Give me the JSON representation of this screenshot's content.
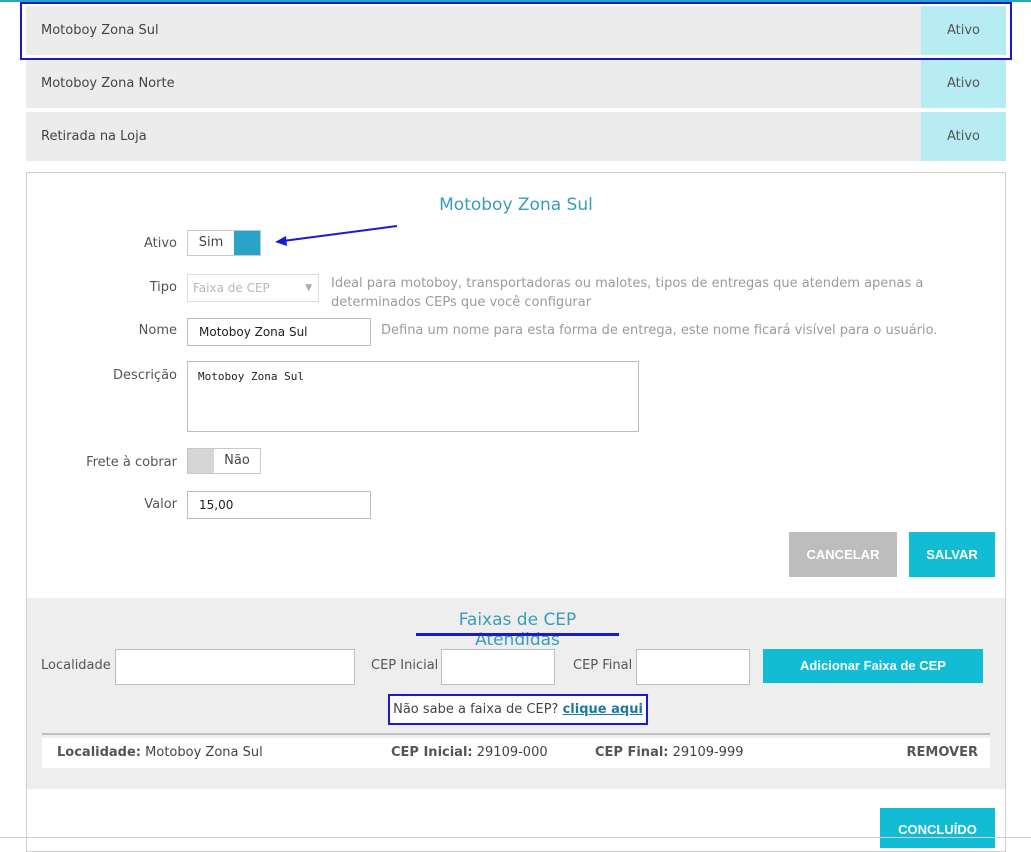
{
  "methods": [
    {
      "name": "Motoboy Zona Sul",
      "status": "Ativo"
    },
    {
      "name": "Motoboy Zona Norte",
      "status": "Ativo"
    },
    {
      "name": "Retirada na Loja",
      "status": "Ativo"
    }
  ],
  "form": {
    "title": "Motoboy Zona Sul",
    "ativo_label": "Ativo",
    "ativo_value": "Sim",
    "tipo_label": "Tipo",
    "tipo_value": "Faixa de CEP",
    "tipo_help_line1": "Ideal para motoboy, transportadoras ou malotes, tipos de entregas que atendem apenas a",
    "tipo_help_line2": "determinados CEPs que você configurar",
    "nome_label": "Nome",
    "nome_value": "Motoboy Zona Sul",
    "nome_help": "Defina um nome para esta forma de entrega, este nome ficará visível para o usuário.",
    "descricao_label": "Descrição",
    "descricao_value": "Motoboy Zona Sul",
    "frete_label": "Frete à cobrar",
    "frete_value": "Não",
    "valor_label": "Valor",
    "valor_value": "15,00",
    "cancel_label": "CANCELAR",
    "save_label": "SALVAR"
  },
  "cep": {
    "title": "Faixas de CEP Atendidas",
    "localidade_label": "Localidade",
    "cep_inicial_label": "CEP Inicial",
    "cep_final_label": "CEP Final",
    "add_label": "Adicionar Faixa de CEP",
    "help_text": "Não sabe a faixa de CEP?",
    "help_link": "clique aqui",
    "rows": [
      {
        "localidade_key": "Localidade:",
        "localidade": "Motoboy Zona Sul",
        "inicial_key": "CEP Inicial:",
        "inicial": "29109-000",
        "final_key": "CEP Final:",
        "final": "29109-999",
        "remove_label": "REMOVER"
      }
    ]
  },
  "done_label": "CONCLUÍDO",
  "colors": {
    "accent": "#29a3c9",
    "button": "#12bcd4",
    "status_bg": "#b6ecf2",
    "highlight": "#1a1ad4"
  }
}
